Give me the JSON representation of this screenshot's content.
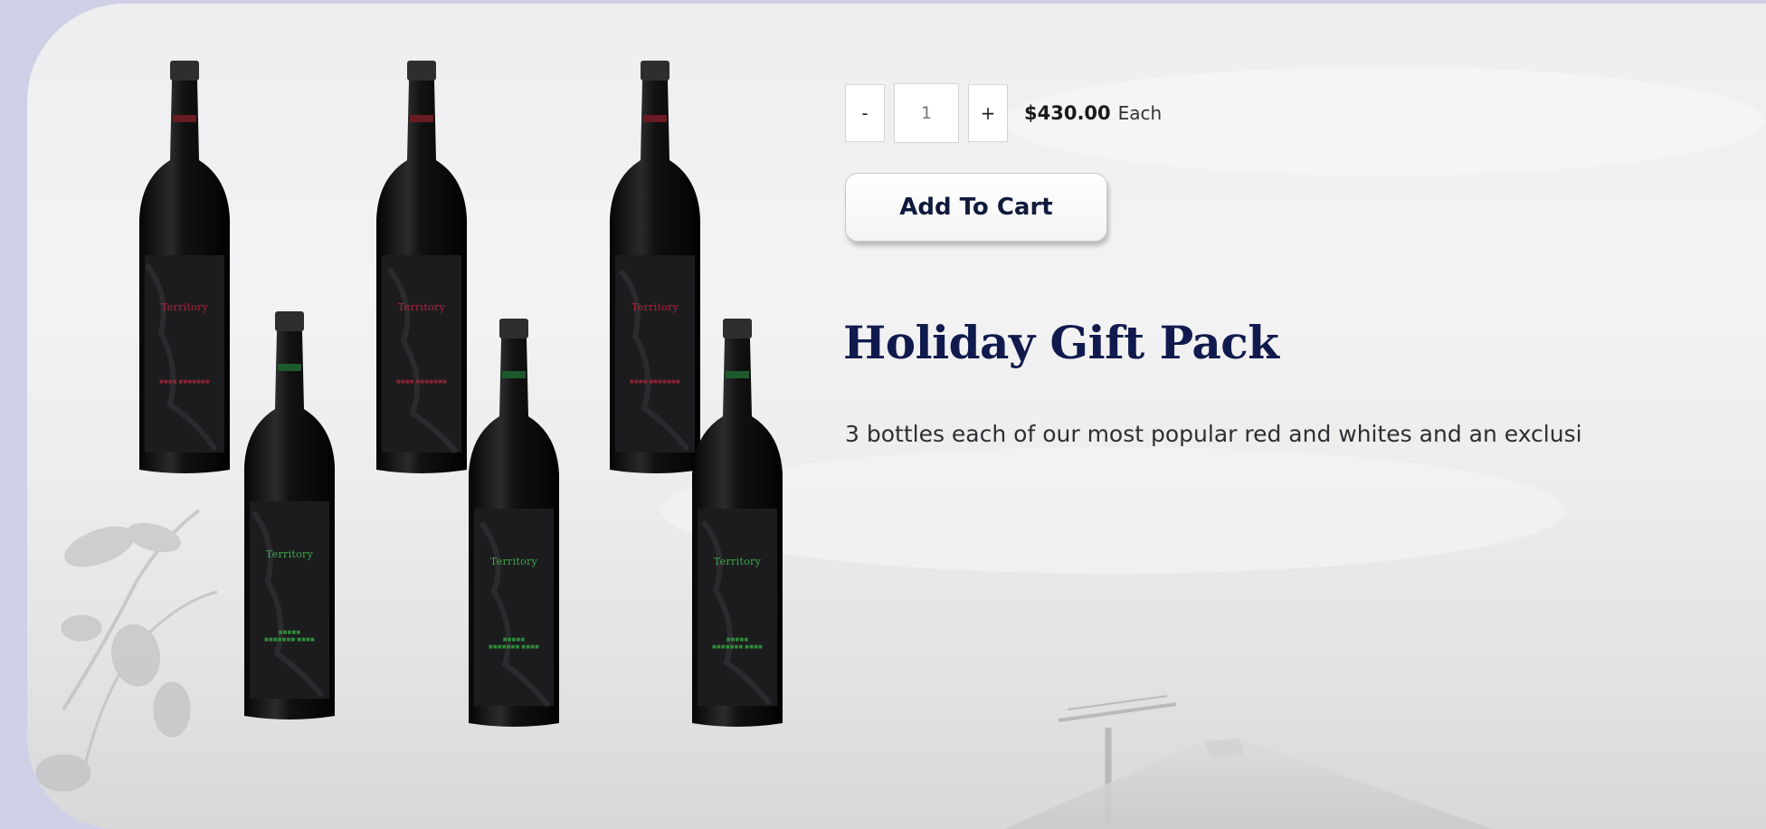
{
  "product": {
    "title": "Holiday Gift Pack",
    "description": "3 bottles each of our most popular red and whites and an exclusi",
    "price": "$430.00",
    "price_unit": "Each",
    "quantity": "1",
    "decrement_label": "-",
    "increment_label": "+",
    "add_to_cart_label": "Add To Cart"
  },
  "image": {
    "bottle_label_text": "Territory",
    "bottles": [
      {
        "label": "Territory",
        "label_color": "#b0243a"
      },
      {
        "label": "Territory",
        "label_color": "#b0243a"
      },
      {
        "label": "Territory",
        "label_color": "#b0243a"
      },
      {
        "label": "Territory",
        "label_color": "#3ea84a"
      },
      {
        "label": "Territory",
        "label_color": "#3ea84a"
      },
      {
        "label": "Territory",
        "label_color": "#3ea84a"
      }
    ]
  },
  "colors": {
    "page_outer": "#cfd0e6",
    "title": "#101a4d",
    "button_text": "#0f1a3c"
  }
}
